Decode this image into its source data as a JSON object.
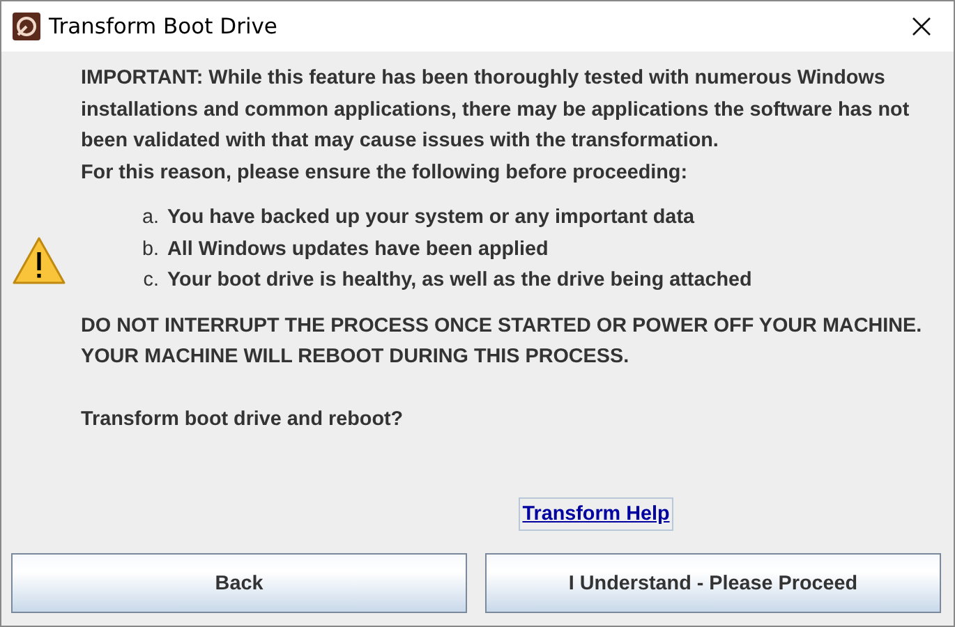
{
  "window": {
    "title": "Transform Boot Drive"
  },
  "message": {
    "intro": "IMPORTANT: While this feature has been thoroughly tested with numerous Windows installations and common applications, there may be applications the software has not been validated with that may cause issues with the transformation.",
    "lead": "For this reason, please ensure the following before proceeding:",
    "checklist": [
      {
        "marker": "a.",
        "text": "You have backed up your system or any important data"
      },
      {
        "marker": "b.",
        "text": "All Windows updates have been applied"
      },
      {
        "marker": "c.",
        "text": "Your boot drive is healthy, as well as the drive being attached"
      }
    ],
    "warning": "DO NOT INTERRUPT THE PROCESS ONCE STARTED OR POWER OFF YOUR MACHINE.",
    "reboot_notice": "YOUR MACHINE WILL REBOOT DURING THIS PROCESS.",
    "question": "Transform boot drive and reboot?"
  },
  "help_link": "Transform Help",
  "buttons": [
    "Back",
    "I Understand - Please Proceed"
  ]
}
